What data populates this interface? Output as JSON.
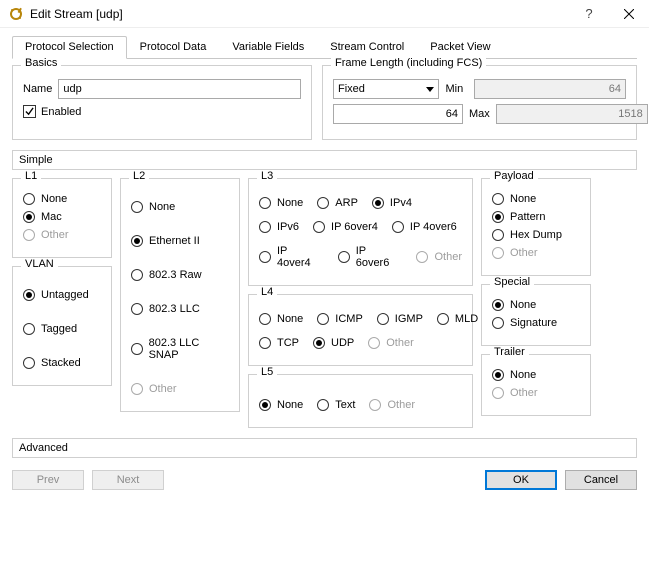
{
  "window": {
    "title": "Edit Stream [udp]"
  },
  "tabs": {
    "t0": "Protocol Selection",
    "t1": "Protocol Data",
    "t2": "Variable Fields",
    "t3": "Stream Control",
    "t4": "Packet View"
  },
  "basics": {
    "legend": "Basics",
    "name_label": "Name",
    "name_value": "udp",
    "enabled_label": "Enabled",
    "enabled": true
  },
  "frame_length": {
    "legend": "Frame Length (including FCS)",
    "mode": "Fixed",
    "value": "64",
    "min_label": "Min",
    "min_value": "64",
    "max_label": "Max",
    "max_value": "1518"
  },
  "sections": {
    "simple": "Simple",
    "advanced": "Advanced"
  },
  "l1": {
    "legend": "L1",
    "none": "None",
    "mac": "Mac",
    "other": "Other",
    "selected": "mac"
  },
  "vlan": {
    "legend": "VLAN",
    "untagged": "Untagged",
    "tagged": "Tagged",
    "stacked": "Stacked",
    "selected": "untagged"
  },
  "l2": {
    "legend": "L2",
    "none": "None",
    "eth2": "Ethernet II",
    "raw": "802.3 Raw",
    "llc": "802.3 LLC",
    "snap": "802.3 LLC SNAP",
    "other": "Other",
    "selected": "eth2"
  },
  "l3": {
    "legend": "L3",
    "none": "None",
    "arp": "ARP",
    "ipv4": "IPv4",
    "ipv6": "IPv6",
    "ip6o4": "IP 6over4",
    "ip4o6": "IP 4over6",
    "ip4o4": "IP 4over4",
    "ip6o6": "IP 6over6",
    "other": "Other",
    "selected": "ipv4"
  },
  "l4": {
    "legend": "L4",
    "none": "None",
    "icmp": "ICMP",
    "igmp": "IGMP",
    "mld": "MLD",
    "tcp": "TCP",
    "udp": "UDP",
    "other": "Other",
    "selected": "udp"
  },
  "l5": {
    "legend": "L5",
    "none": "None",
    "text": "Text",
    "other": "Other",
    "selected": "none"
  },
  "payload": {
    "legend": "Payload",
    "none": "None",
    "pattern": "Pattern",
    "hex": "Hex Dump",
    "other": "Other",
    "selected": "pattern"
  },
  "special": {
    "legend": "Special",
    "none": "None",
    "signature": "Signature",
    "selected": "none"
  },
  "trailer": {
    "legend": "Trailer",
    "none": "None",
    "other": "Other",
    "selected": "none"
  },
  "buttons": {
    "prev": "Prev",
    "next": "Next",
    "ok": "OK",
    "cancel": "Cancel"
  }
}
